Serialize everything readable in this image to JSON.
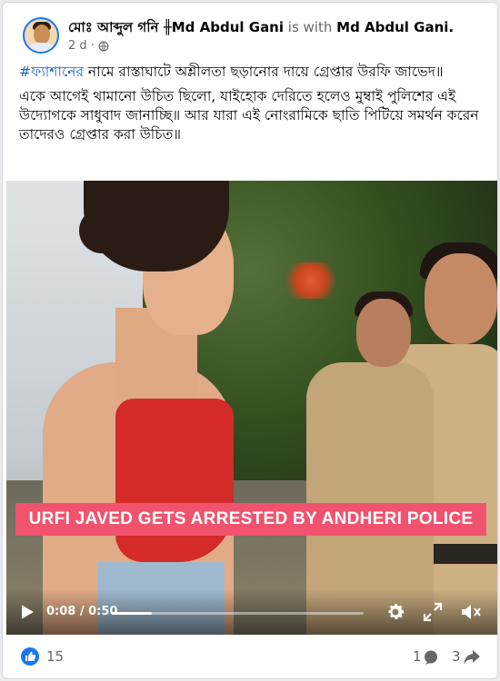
{
  "post": {
    "author_name": "মোঃ আব্দুল গনি ╫Md Abdul Gani",
    "with_text": "is with",
    "tagged_name": "Md Abdul Gani.",
    "timestamp": "2 d ·",
    "hashtag": "#ফ্যাশানের",
    "line1_rest": " নামে রাস্তাঘাটে অশ্লীলতা ছড়ানোর দায়ে গ্রেপ্তার উরফি জাভেদ॥",
    "paragraph2": "একে আগেই থামানো উচিত ছিলো, যাইহোক দেরিতে হলেও মুম্বাই পুলিশের এই উদ্যোগকে সাধুবাদ জানাচ্ছি॥ আর যারা এই নোংরামিকে ছাতি পিটিয়ে সমর্থন করেন তাদেরও গ্রেপ্তার করা উচিত॥"
  },
  "video": {
    "caption": "URFI JAVED GETS ARRESTED BY ANDHERI POLICE",
    "time_display": "0:08 / 0:50",
    "progress": 0.16
  },
  "footer": {
    "like_count": "15",
    "comment_count": "1",
    "share_count": "3"
  },
  "colors": {
    "accent": "#1877f2",
    "caption_bg": "#f1536e"
  }
}
